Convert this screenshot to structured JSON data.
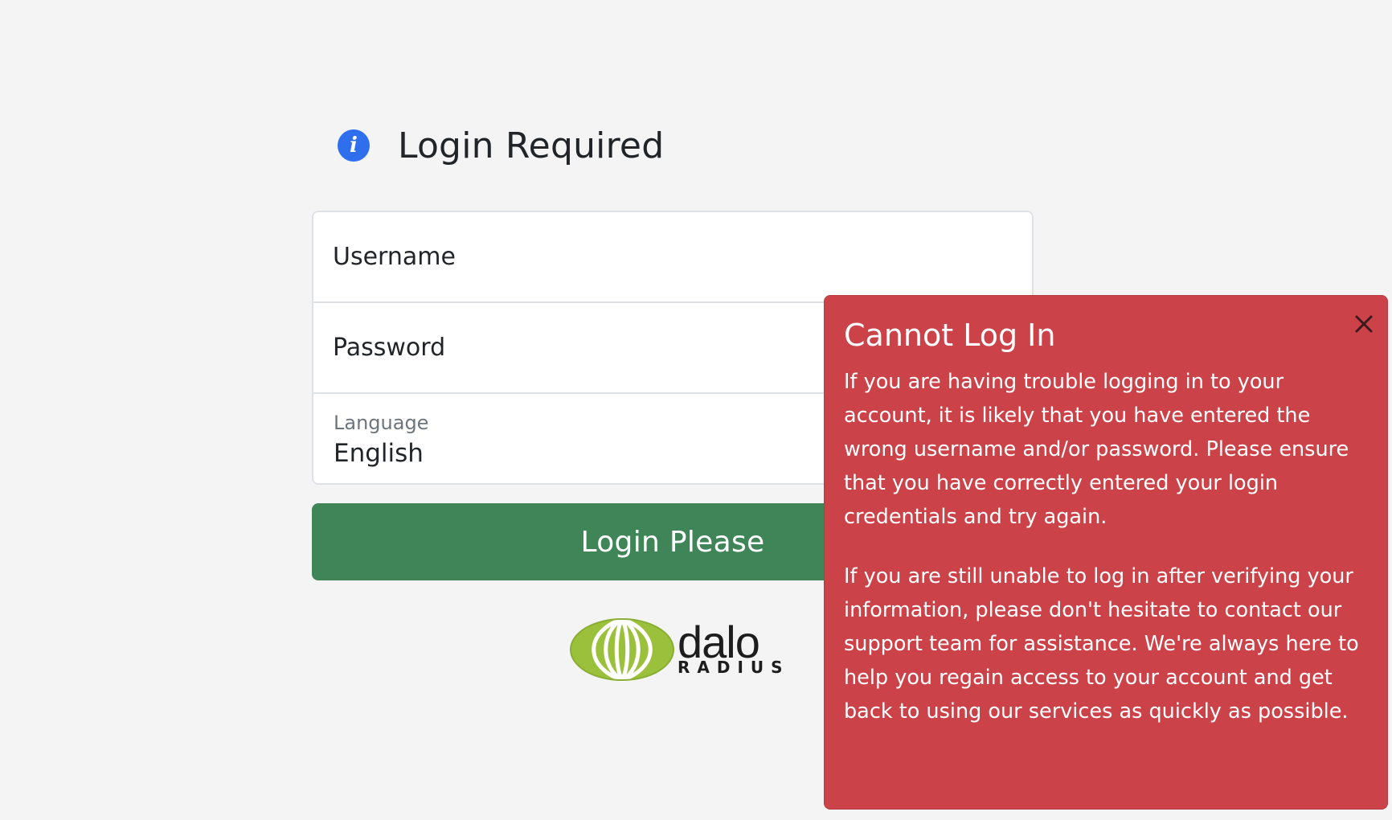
{
  "heading": {
    "icon": "info-icon",
    "icon_glyph": "i",
    "title": "Login Required"
  },
  "form": {
    "username_placeholder": "Username",
    "password_placeholder": "Password",
    "language_label": "Language",
    "language_value": "English",
    "submit_label": "Login Please"
  },
  "logo": {
    "text": "dalo",
    "subtext": "RADIUS"
  },
  "toast": {
    "title": "Cannot Log In",
    "close_icon": "close-icon",
    "paragraphs": [
      "If you are having trouble logging in to your account, it is likely that you have entered the wrong username and/or password. Please ensure that you have correctly entered your login credentials and try again.",
      "If you are still unable to log in after verifying your information, please don't hesitate to contact our support team for assistance. We're always here to help you regain access to your account and get back to using our services as quickly as possible."
    ]
  },
  "colors": {
    "background": "#f4f4f4",
    "info_blue": "#2f6fed",
    "success_green": "#408558",
    "danger_red": "#cc4249",
    "logo_green": "#9bc13c"
  }
}
